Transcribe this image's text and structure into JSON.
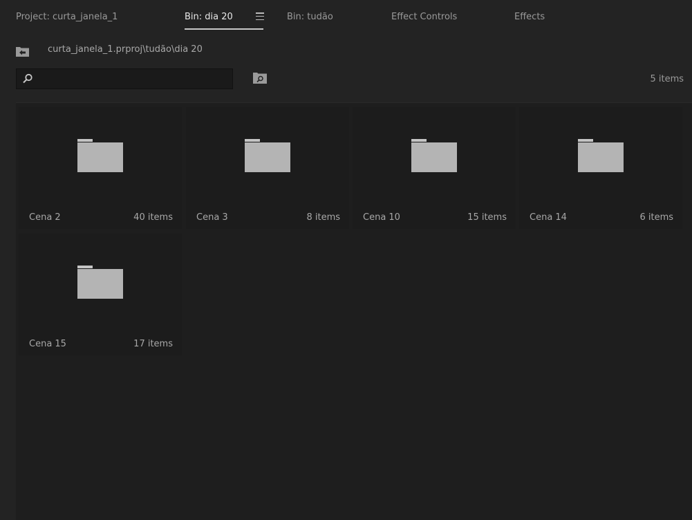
{
  "tabs": [
    {
      "label": "Project: curta_janela_1",
      "active": false
    },
    {
      "label": "Bin: dia 20",
      "active": true
    },
    {
      "label": "Bin: tudão",
      "active": false
    },
    {
      "label": "Effect Controls",
      "active": false
    },
    {
      "label": "Effects",
      "active": false
    }
  ],
  "path": "curta_janela_1.prproj\\tudão\\dia 20",
  "search": {
    "value": "",
    "placeholder": ""
  },
  "item_count": "5 items",
  "bins": [
    {
      "name": "Cena 2",
      "count": "40 items"
    },
    {
      "name": "Cena 3",
      "count": "8 items"
    },
    {
      "name": "Cena 10",
      "count": "15 items"
    },
    {
      "name": "Cena 14",
      "count": "6 items"
    },
    {
      "name": "Cena 15",
      "count": "17 items"
    }
  ],
  "icons": {
    "tab_menu": "hamburger-menu-icon",
    "navigate_up": "folder-up-icon",
    "search": "magnifier-icon",
    "find": "find-folder-icon",
    "bin": "folder-icon"
  },
  "colors": {
    "background": "#232323",
    "tile": "#1c1c1c",
    "folder": "#b4b4b4",
    "active_tab": "#e8e8e8"
  }
}
